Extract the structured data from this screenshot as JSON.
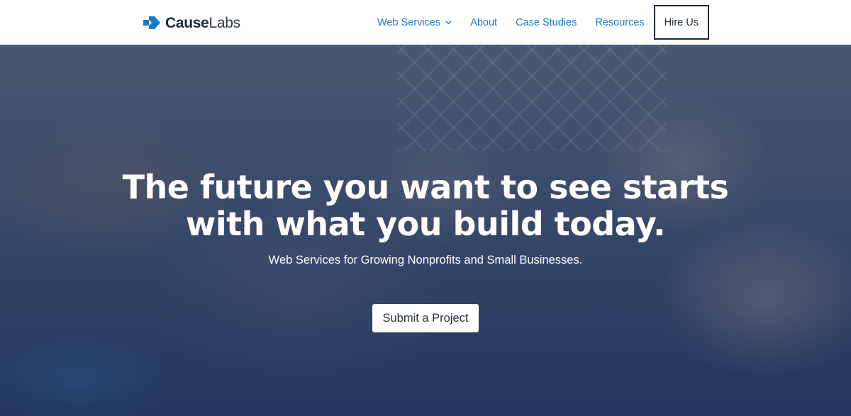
{
  "brand": {
    "name_part1": "Cause",
    "name_part2": "Labs",
    "accent_color": "#1a7bc4"
  },
  "nav": {
    "items": [
      {
        "label": "Web Services",
        "has_dropdown": true
      },
      {
        "label": "About"
      },
      {
        "label": "Case Studies"
      },
      {
        "label": "Resources"
      }
    ],
    "cta_label": "Hire Us"
  },
  "hero": {
    "headline_line1": "The future you want to see starts",
    "headline_line2": "with what you build today.",
    "subheadline": "Web Services for Growing Nonprofits and Small Businesses.",
    "button_label": "Submit a Project"
  },
  "icons": {
    "logo": "causelabs-logo-icon",
    "dropdown": "chevron-down-icon"
  }
}
